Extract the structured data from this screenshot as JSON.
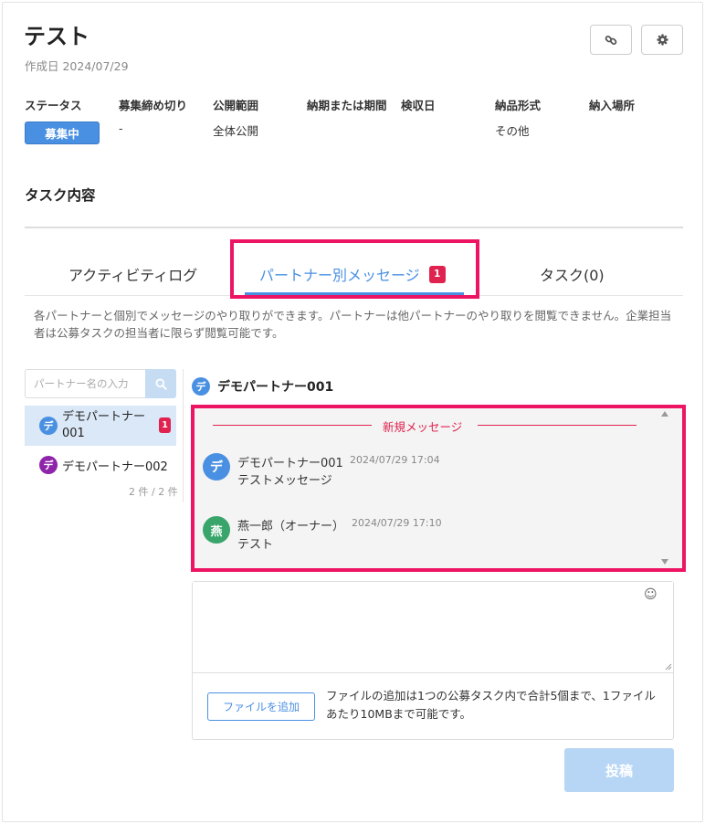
{
  "header": {
    "title": "テスト",
    "created": "作成日 2024/07/29",
    "link_icon": "link-icon",
    "settings_icon": "gear-icon"
  },
  "meta": {
    "labels": [
      "ステータス",
      "募集締め切り",
      "公開範囲",
      "納期または期間",
      "検収日",
      "納品形式",
      "納入場所"
    ],
    "status": "募集中",
    "deadline": "-",
    "visibility": "全体公開",
    "delivery_format": "その他",
    "status_color": "#4a90e2"
  },
  "section_title": "タスク内容",
  "tabs": {
    "activity": "アクティビティログ",
    "partner_messages": "パートナー別メッセージ",
    "partner_badge": "1",
    "tasks": "タスク(0)"
  },
  "description": "各パートナーと個別でメッセージのやり取りができます。パートナーは他パートナーのやり取りを閲覧できません。企業担当者は公募タスクの担当者に限らず閲覧可能です。",
  "sidebar": {
    "search_placeholder": "パートナー名の入力",
    "partners": [
      {
        "avatar": "デ",
        "name_line1": "デモパートナー",
        "name_line2": "001",
        "badge": "1",
        "color": "#4a90e2"
      },
      {
        "avatar": "デ",
        "name": "デモパートナー002",
        "color": "#8e24aa"
      }
    ],
    "count": "2 件 / 2 件"
  },
  "conversation": {
    "avatar": "デ",
    "title": "デモパートナー001",
    "new_messages_label": "新規メッセージ",
    "messages": [
      {
        "avatar": "デ",
        "avatar_color": "#4a90e2",
        "name": "デモパートナー001",
        "time": "2024/07/29 17:04",
        "body": "テストメッセージ"
      },
      {
        "avatar": "燕",
        "avatar_color": "#3aa56b",
        "name": "燕一郎（オーナー）",
        "time": "2024/07/29 17:10",
        "body": "テスト"
      }
    ]
  },
  "compose": {
    "emoji_icon": "smiley-icon",
    "file_button": "ファイルを追加",
    "file_note": "ファイルの追加は1つの公募タスク内で合計5個まで、1ファイルあたり10MBまで可能です。",
    "post_button": "投稿"
  }
}
